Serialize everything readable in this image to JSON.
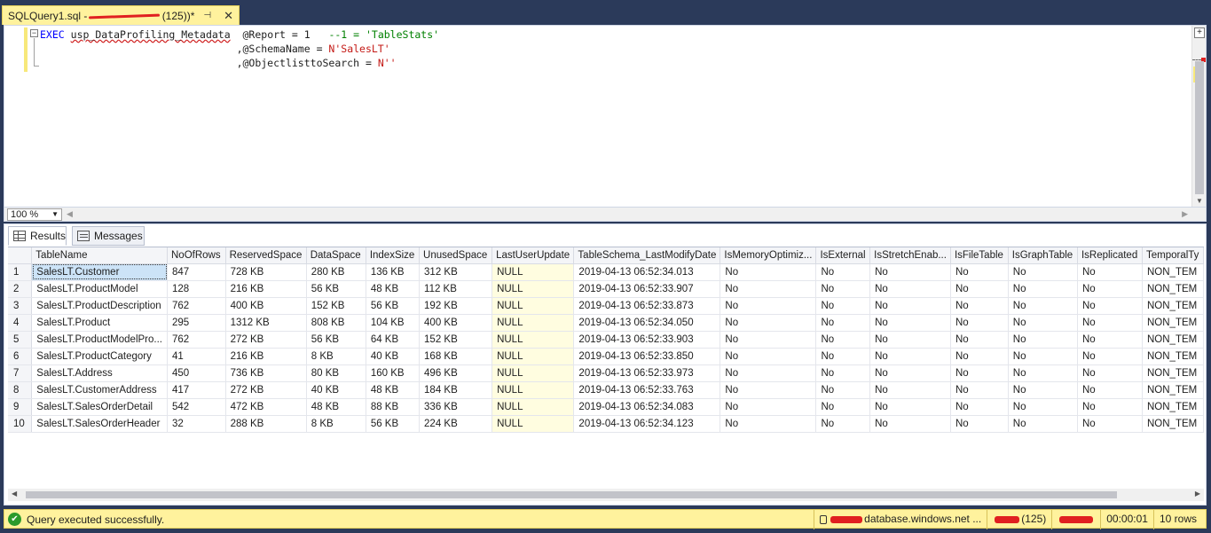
{
  "tab": {
    "title_prefix": "SQLQuery1.sql - ",
    "title_suffix": "(125))*",
    "pin_glyph": "⊣",
    "close_glyph": "✕"
  },
  "editor": {
    "line1": {
      "kw": "EXEC",
      "proc": "usp_DataProfiling_Metadata",
      "param": "  @Report = 1   ",
      "comment": "--1 = 'TableStats'"
    },
    "line2": {
      "prefix": ",@SchemaName = ",
      "value": "N'SalesLT'"
    },
    "line3": {
      "prefix": ",@ObjectlisttoSearch = ",
      "value": "N''"
    }
  },
  "zoom": {
    "value": "100 %"
  },
  "results_tabs": [
    {
      "label": "Results",
      "icon": "grid-icon"
    },
    {
      "label": "Messages",
      "icon": "messages-icon"
    }
  ],
  "grid": {
    "columns": [
      "TableName",
      "NoOfRows",
      "ReservedSpace",
      "DataSpace",
      "IndexSize",
      "UnusedSpace",
      "LastUserUpdate",
      "TableSchema_LastModifyDate",
      "IsMemoryOptimiz...",
      "IsExternal",
      "IsStretchEnab...",
      "IsFileTable",
      "IsGraphTable",
      "IsReplicated",
      "TemporalTy"
    ],
    "rows": [
      [
        "1",
        "SalesLT.Customer",
        "847",
        "728 KB",
        "280 KB",
        "136 KB",
        "312 KB",
        "NULL",
        "2019-04-13 06:52:34.013",
        "No",
        "No",
        "No",
        "No",
        "No",
        "No",
        "NON_TEM"
      ],
      [
        "2",
        "SalesLT.ProductModel",
        "128",
        "216 KB",
        "56 KB",
        "48 KB",
        "112 KB",
        "NULL",
        "2019-04-13 06:52:33.907",
        "No",
        "No",
        "No",
        "No",
        "No",
        "No",
        "NON_TEM"
      ],
      [
        "3",
        "SalesLT.ProductDescription",
        "762",
        "400 KB",
        "152 KB",
        "56 KB",
        "192 KB",
        "NULL",
        "2019-04-13 06:52:33.873",
        "No",
        "No",
        "No",
        "No",
        "No",
        "No",
        "NON_TEM"
      ],
      [
        "4",
        "SalesLT.Product",
        "295",
        "1312 KB",
        "808 KB",
        "104 KB",
        "400 KB",
        "NULL",
        "2019-04-13 06:52:34.050",
        "No",
        "No",
        "No",
        "No",
        "No",
        "No",
        "NON_TEM"
      ],
      [
        "5",
        "SalesLT.ProductModelPro...",
        "762",
        "272 KB",
        "56 KB",
        "64 KB",
        "152 KB",
        "NULL",
        "2019-04-13 06:52:33.903",
        "No",
        "No",
        "No",
        "No",
        "No",
        "No",
        "NON_TEM"
      ],
      [
        "6",
        "SalesLT.ProductCategory",
        "41",
        "216 KB",
        "8 KB",
        "40 KB",
        "168 KB",
        "NULL",
        "2019-04-13 06:52:33.850",
        "No",
        "No",
        "No",
        "No",
        "No",
        "No",
        "NON_TEM"
      ],
      [
        "7",
        "SalesLT.Address",
        "450",
        "736 KB",
        "80 KB",
        "160 KB",
        "496 KB",
        "NULL",
        "2019-04-13 06:52:33.973",
        "No",
        "No",
        "No",
        "No",
        "No",
        "No",
        "NON_TEM"
      ],
      [
        "8",
        "SalesLT.CustomerAddress",
        "417",
        "272 KB",
        "40 KB",
        "48 KB",
        "184 KB",
        "NULL",
        "2019-04-13 06:52:33.763",
        "No",
        "No",
        "No",
        "No",
        "No",
        "No",
        "NON_TEM"
      ],
      [
        "9",
        "SalesLT.SalesOrderDetail",
        "542",
        "472 KB",
        "48 KB",
        "88 KB",
        "336 KB",
        "NULL",
        "2019-04-13 06:52:34.083",
        "No",
        "No",
        "No",
        "No",
        "No",
        "No",
        "NON_TEM"
      ],
      [
        "10",
        "SalesLT.SalesOrderHeader",
        "32",
        "288 KB",
        "8 KB",
        "56 KB",
        "224 KB",
        "NULL",
        "2019-04-13 06:52:34.123",
        "No",
        "No",
        "No",
        "No",
        "No",
        "No",
        "NON_TEM"
      ]
    ]
  },
  "status": {
    "message": "Query executed successfully.",
    "server_suffix": "database.windows.net ...",
    "spid": "(125)",
    "elapsed": "00:00:01",
    "rows": "10 rows"
  },
  "colors": {
    "status_yellow": "#fff29d",
    "null_cell": "#fffde0",
    "selected_cell": "#cce3f7",
    "keyword_blue": "#0000ff",
    "string_red": "#c41a16",
    "comment_green": "#008000"
  }
}
